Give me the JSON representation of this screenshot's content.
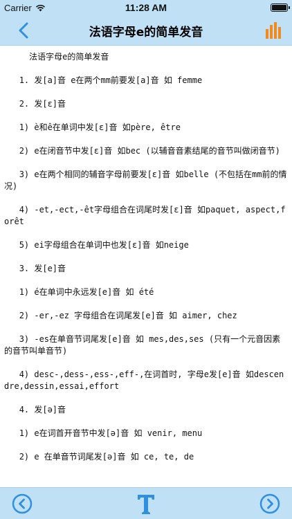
{
  "status": {
    "carrier": "Carrier",
    "time": "11:28 AM"
  },
  "nav": {
    "title": "法语字母e的简单发音"
  },
  "icons": {
    "back": "chevron-left-icon",
    "chart": "bar-chart-icon",
    "prev": "circle-chevron-left-icon",
    "next": "circle-chevron-right-icon",
    "font": "text-format-icon"
  },
  "colors": {
    "accent": "#2f8fe0",
    "chart": "#f08a1c",
    "bar": "#bfe0f5"
  },
  "article": {
    "lines": [
      "     法语字母e的简单发音",
      "   1. 发[a]音 e在两个mm前要发[a]音 如 femme",
      "   2. 发[ɛ]音",
      "   1) è和ê在单词中发[ɛ]音 如père, être",
      "   2) e在闭音节中发[ɛ]音 如bec (以辅音音素结尾的音节叫做闭音节)",
      "   3) e在两个相同的辅音字母前要发[ɛ]音 如belle (不包括在mm前的情况)",
      "   4) -et,-ect,-êt字母组合在词尾时发[ɛ]音 如paquet, aspect,forêt",
      "   5) ei字母组合在单词中也发[ɛ]音 如neige",
      "   3. 发[e]音",
      "   1) é在单词中永远发[e]音 如 été",
      "   2) -er,-ez 字母组合在词尾发[e]音 如 aimer, chez",
      "   3) -es在单音节词尾发[e]音 如 mes,des,ses (只有一个元音因素的音节叫单音节)",
      "   4) desc-,dess-,ess-,eff-,在词首时, 字母e发[e]音 如descendre,dessin,essai,effort",
      "   4. 发[ə]音",
      "   1) e在词首开音节中发[ə]音 如 venir, menu",
      "   2) e 在单音节词尾发[ə]音 如 ce, te, de"
    ]
  }
}
